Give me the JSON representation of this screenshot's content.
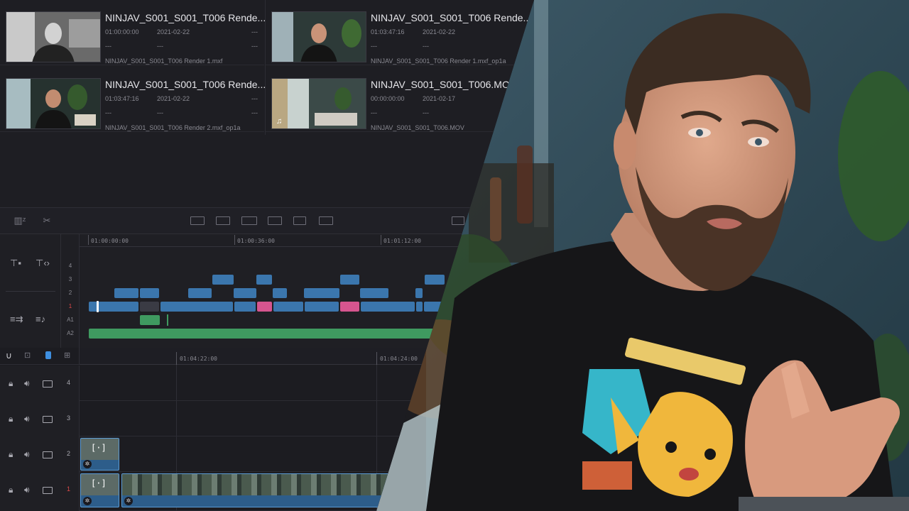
{
  "colors": {
    "video_clip": "#3b76ad",
    "video_clip_pink": "#d6558f",
    "audio_clip": "#3f9a60",
    "active_track": "#e04a4a",
    "panel_bg": "#1f1f24"
  },
  "media_pool": {
    "clips": [
      {
        "name": "NINJAV_S001_S001_T006 Rende...",
        "timecode": "01:00:00:00",
        "date": "2021-02-22",
        "dash_right": "---",
        "row2": [
          "---",
          "---",
          "---"
        ],
        "file": "NINJAV_S001_S001_T006 Render 1.mxf"
      },
      {
        "name": "NINJAV_S001_S001_T006 Rende...",
        "timecode": "01:03:47:16",
        "date": "2021-02-22",
        "dash_right": "---",
        "row2": [
          "---",
          "---",
          "---"
        ],
        "file": "NINJAV_S001_S001_T006 Render 1.mxf_op1a"
      },
      {
        "name": "NINJAV_S001_S001_T006 Rende...",
        "timecode": "01:03:47:16",
        "date": "2021-02-22",
        "dash_right": "---",
        "row2": [
          "---",
          "---",
          "---"
        ],
        "file": "NINJAV_S001_S001_T006 Render 2.mxf_op1a"
      },
      {
        "name": "NINJAV_S001_S001_T006.MOV",
        "timecode": "00:00:00:00",
        "date": "2021-02-17",
        "dash_right": "---",
        "row2": [
          "---",
          "---",
          "---"
        ],
        "file": "NINJAV_S001_S001_T006.MOV"
      }
    ]
  },
  "toolbar": {
    "icons": [
      "snooze-edit-icon",
      "razor-icon",
      "insert-icon",
      "overwrite-icon",
      "replace-icon",
      "place-on-top-icon",
      "append-icon",
      "ripple-icon",
      "close-up-icon"
    ]
  },
  "upper_timeline": {
    "ruler": [
      "01:00:00:00",
      "01:00:36:00",
      "01:01:12:00"
    ],
    "track_numbers": [
      "4",
      "3",
      "2",
      "1",
      "A1",
      "A2"
    ]
  },
  "lower_timeline": {
    "ruler": [
      "01:04:22:00",
      "01:04:24:00"
    ],
    "tracks": [
      "4",
      "3",
      "2",
      "1"
    ]
  }
}
